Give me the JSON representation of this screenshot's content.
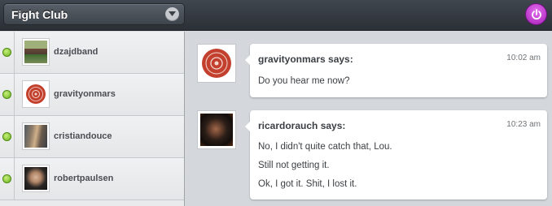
{
  "header": {
    "room_name": "Fight Club"
  },
  "sidebar": {
    "users": [
      {
        "username": "dzajdband",
        "status": "online"
      },
      {
        "username": "gravityonmars",
        "status": "online"
      },
      {
        "username": "cristiandouce",
        "status": "online"
      },
      {
        "username": "robertpaulsen",
        "status": "online"
      }
    ]
  },
  "messages": [
    {
      "sender": "gravityonmars says:",
      "time": "10:02 am",
      "lines": [
        "Do you hear me now?"
      ]
    },
    {
      "sender": "ricardorauch says:",
      "time": "10:23 am",
      "lines": [
        "No, I didn't quite catch that, Lou.",
        "Still not getting it.",
        "Ok, I got it. Shit, I lost it."
      ]
    }
  ],
  "colors": {
    "online": "#6cb21f",
    "power_button": "#c02fd0",
    "topbar": "#2f343a"
  }
}
